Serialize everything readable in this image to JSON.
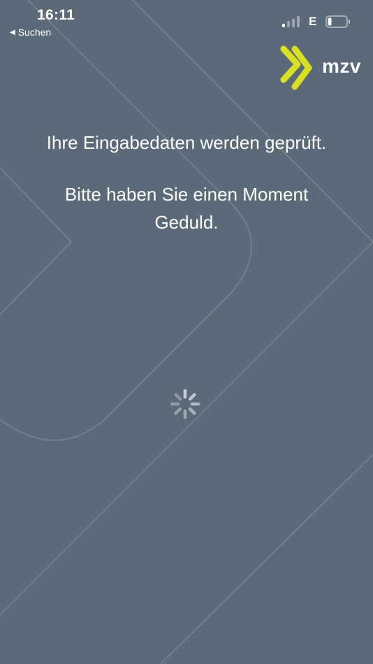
{
  "status_bar": {
    "time": "16:11",
    "back_label": "Suchen",
    "network": "E"
  },
  "brand": {
    "logo_text": "mzv",
    "accent_color": "#d9e021",
    "background_color": "#5b6a79"
  },
  "message": {
    "line1": "Ihre Eingabedaten werden geprüft.",
    "line2": "Bitte haben Sie einen Moment Geduld."
  },
  "icons": {
    "back": "back-arrow-icon",
    "signal": "cellular-signal-icon",
    "battery": "battery-icon",
    "spinner": "loading-spinner-icon",
    "logo_mark": "chevron-logo-icon"
  }
}
